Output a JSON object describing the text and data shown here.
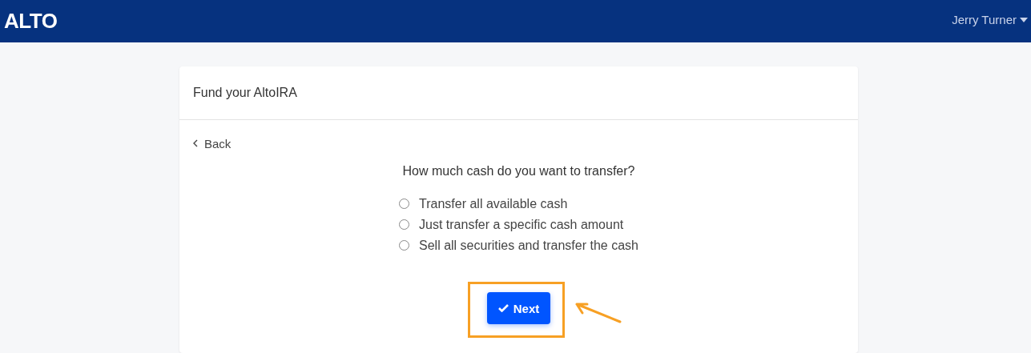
{
  "navbar": {
    "logo": "ALTO",
    "user_menu": "Jerry Turner"
  },
  "card": {
    "title": "Fund your AltoIRA",
    "back_link": "Back",
    "question": "How much cash do you want to transfer?",
    "options": [
      {
        "label": "Transfer all available cash",
        "selected": false
      },
      {
        "label": "Just transfer a specific cash amount",
        "selected": false
      },
      {
        "label": "Sell all securities and transfer the cash",
        "selected": false
      }
    ],
    "next_button": "Next",
    "annotation": {
      "highlight": true,
      "arrow": true
    }
  }
}
